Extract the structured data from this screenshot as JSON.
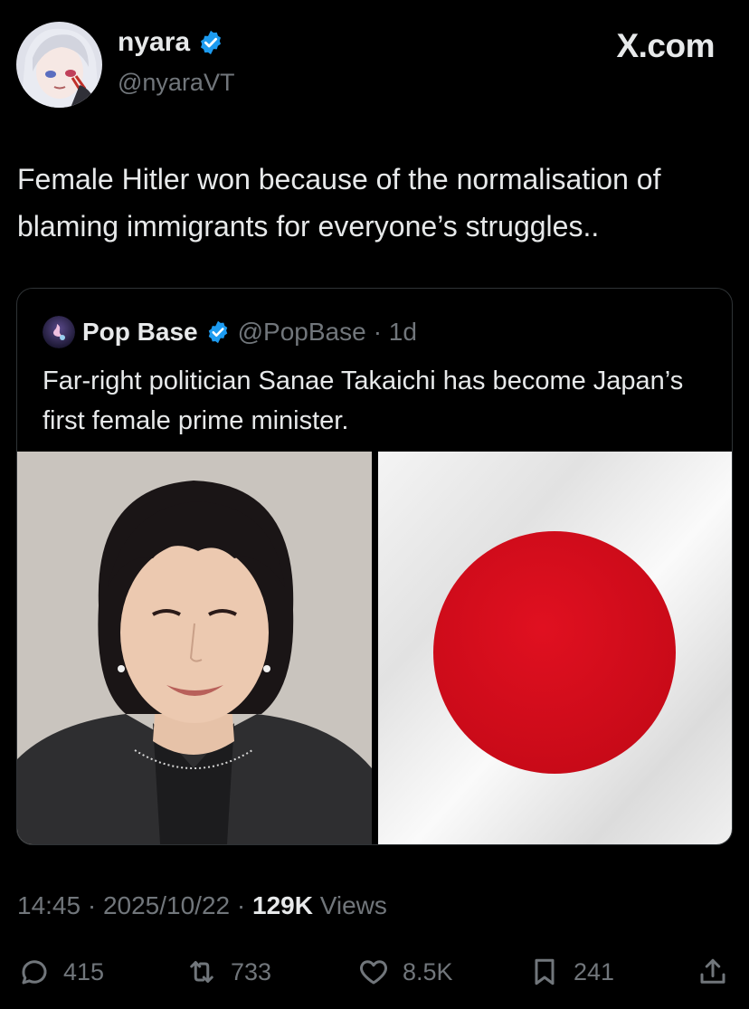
{
  "author": {
    "display_name": "nyara",
    "handle": "@nyaraVT",
    "verified": true
  },
  "site_logo": "X.com",
  "tweet": {
    "text": "Female Hitler won because of the normalisation of blaming immigrants for everyone’s struggles.."
  },
  "quote": {
    "display_name": "Pop Base",
    "handle": "@PopBase",
    "age": "· 1d",
    "text": "Far-right politician Sanae Takaichi has become Japan’s first female prime minister.",
    "images": [
      "portrait-photo",
      "japan-flag-image"
    ]
  },
  "meta": {
    "time": "14:45",
    "sep1": "·",
    "date": "2025/10/22",
    "sep2": "·",
    "views_count": "129K",
    "views_label": "Views"
  },
  "actions": {
    "replies": "415",
    "reposts": "733",
    "likes": "8.5K",
    "bookmarks": "241"
  },
  "colors": {
    "background": "#000000",
    "text": "#e7e9ea",
    "secondary": "#71767b",
    "verified": "#1d9bf0",
    "flag_red": "#d40e1c"
  }
}
